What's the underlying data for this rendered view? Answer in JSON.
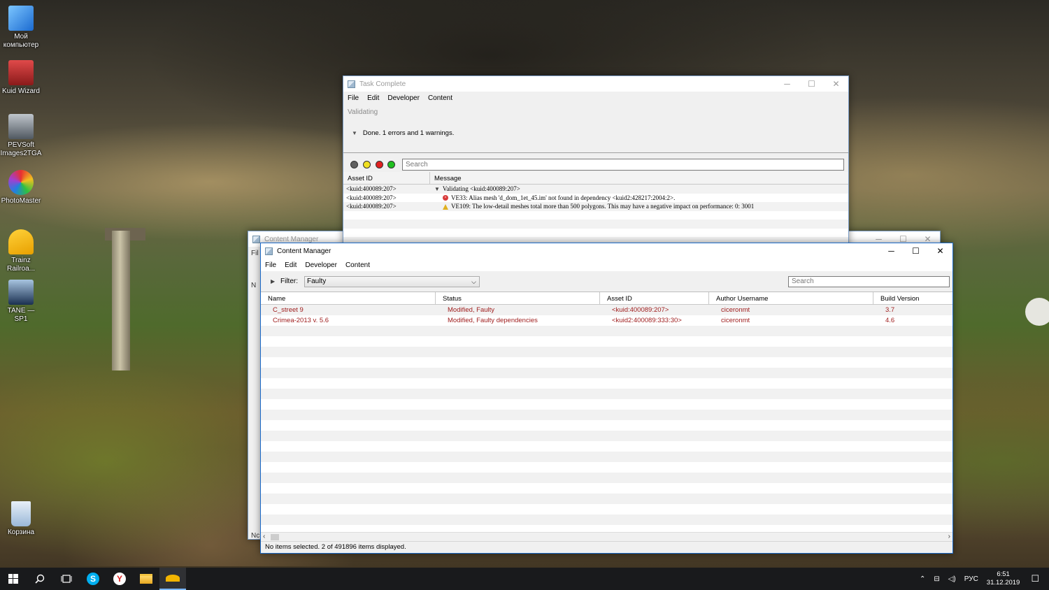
{
  "desktop": {
    "icons": [
      {
        "label": "Мой компьютер",
        "color": "#3a8ee6"
      },
      {
        "label": "Kuid Wizard",
        "color": "#c23030"
      },
      {
        "label": "PEVSoft Images2TGA",
        "color": "#7a8088"
      },
      {
        "label": "PhotoMaster",
        "color": "#e84a7a"
      },
      {
        "label": "Trainz Railroa...",
        "color": "#f2b400"
      },
      {
        "label": "TANE — SP1",
        "color": "#2b5a8a"
      },
      {
        "label": "Корзина",
        "color": "#9ab8d8"
      }
    ]
  },
  "task_window": {
    "title": "Task Complete",
    "menu": [
      "File",
      "Edit",
      "Developer",
      "Content"
    ],
    "status_label": "Validating",
    "summary": "Done. 1 errors and 1 warnings.",
    "search_placeholder": "Search",
    "filter_dots": [
      "#606060",
      "#f0e020",
      "#e02020",
      "#20c020"
    ],
    "columns": [
      "Asset ID",
      "Message"
    ],
    "rows": [
      {
        "asset_id": "<kuid:400089:207>",
        "type": "group",
        "message": "Validating <kuid:400089:207>"
      },
      {
        "asset_id": "<kuid:400089:207>",
        "type": "error",
        "message": "VE33: Alias mesh 'd_dom_1et_45.im' not found in dependency <kuid2:428217:2004:2>."
      },
      {
        "asset_id": "<kuid:400089:207>",
        "type": "warning",
        "message": "VE109: The low-detail meshes total more than 500 polygons. This may have a negative impact on performance: 0: 3001"
      }
    ]
  },
  "back_window": {
    "title": "Content Manager",
    "side_texts": [
      "Fil",
      "N",
      "Nc"
    ]
  },
  "content_manager": {
    "title": "Content Manager",
    "menu": [
      "File",
      "Edit",
      "Developer",
      "Content"
    ],
    "filter_label": "Filter:",
    "filter_value": "Faulty",
    "search_placeholder": "Search",
    "columns": [
      "Name",
      "Status",
      "Asset ID",
      "Author Username",
      "Build Version"
    ],
    "rows": [
      {
        "name": "C_street 9",
        "status": "Modified, Faulty",
        "asset_id": "<kuid:400089:207>",
        "author": "ciceronmt",
        "build": "3.7"
      },
      {
        "name": "Crimea-2013 v. 5.6",
        "status": "Modified, Faulty dependencies",
        "asset_id": "<kuid2:400089:333:30>",
        "author": "ciceronmt",
        "build": "4.6"
      }
    ],
    "status_text": "No items selected. 2 of 491896 items displayed."
  },
  "taskbar": {
    "language": "РУС",
    "time": "6:51",
    "date": "31.12.2019"
  }
}
